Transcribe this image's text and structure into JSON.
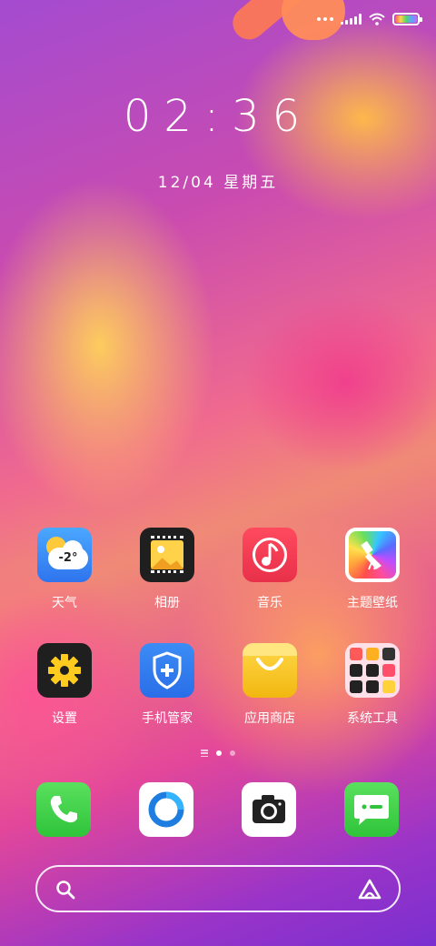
{
  "status_bar": {
    "signal_icon": "cellular-signal-icon",
    "wifi_icon": "wifi-icon",
    "battery_icon": "battery-icon"
  },
  "lockscreen": {
    "time": "02:36",
    "date": "12/04 星期五"
  },
  "apps": [
    {
      "label": "天气",
      "icon": "weather-icon",
      "temp": "-2°"
    },
    {
      "label": "相册",
      "icon": "gallery-icon"
    },
    {
      "label": "音乐",
      "icon": "music-icon"
    },
    {
      "label": "主题壁纸",
      "icon": "theme-brush-icon"
    },
    {
      "label": "设置",
      "icon": "settings-gear-icon"
    },
    {
      "label": "手机管家",
      "icon": "phone-manager-shield-icon"
    },
    {
      "label": "应用商店",
      "icon": "app-store-bag-icon"
    },
    {
      "label": "系统工具",
      "icon": "system-tools-folder-icon"
    }
  ],
  "pager": {
    "pages": 2,
    "active_page": 1
  },
  "dock": [
    {
      "icon": "phone-icon"
    },
    {
      "icon": "browser-icon"
    },
    {
      "icon": "camera-icon"
    },
    {
      "icon": "messages-icon"
    }
  ],
  "search_bar": {
    "search_icon": "search-icon",
    "assistant_icon": "assistant-icon"
  },
  "colors": {
    "weather": "#3a8ff5",
    "music": "#f0394e",
    "settings": "#1e1e1e",
    "phone_manager": "#2f7ef0",
    "app_store": "#f5c419",
    "phone": "#3ecf45",
    "messages": "#3ecf45"
  }
}
